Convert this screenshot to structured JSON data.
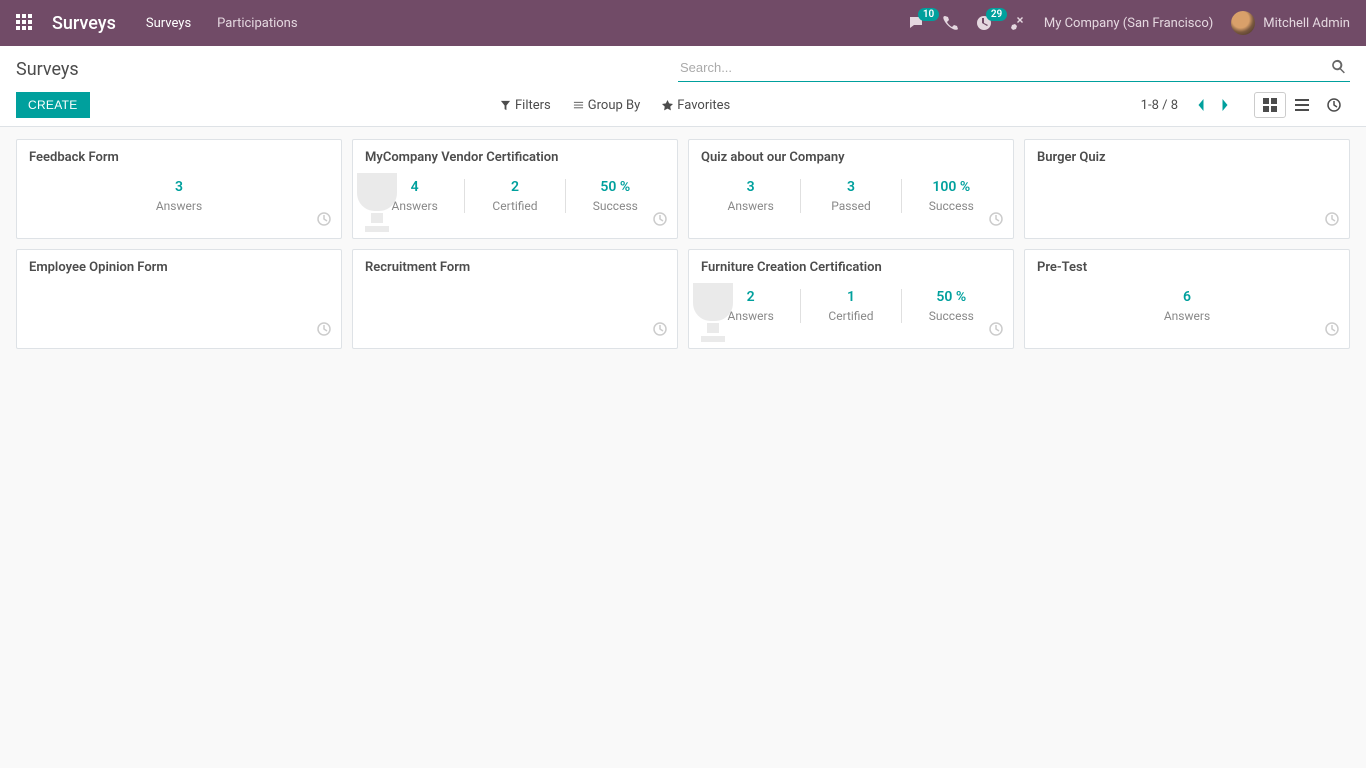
{
  "navbar": {
    "brand": "Surveys",
    "menu": [
      {
        "label": "Surveys",
        "active": true
      },
      {
        "label": "Participations",
        "active": false
      }
    ],
    "messages_count": "10",
    "activities_count": "29",
    "company": "My Company (San Francisco)",
    "user": "Mitchell Admin"
  },
  "control": {
    "breadcrumb": "Surveys",
    "search_placeholder": "Search...",
    "create_label": "CREATE",
    "filters_label": "Filters",
    "groupby_label": "Group By",
    "favorites_label": "Favorites",
    "pager": "1-8 / 8"
  },
  "stat_labels": {
    "answers": "Answers",
    "certified": "Certified",
    "passed": "Passed",
    "success": "Success"
  },
  "cards": [
    {
      "title": "Feedback Form",
      "type": "answers",
      "answers": "3"
    },
    {
      "title": "MyCompany Vendor Certification",
      "type": "cert",
      "answers": "4",
      "mid_val": "2",
      "mid_lbl": "certified",
      "success": "50 %",
      "trophy": true
    },
    {
      "title": "Quiz about our Company",
      "type": "cert",
      "answers": "3",
      "mid_val": "3",
      "mid_lbl": "passed",
      "success": "100 %"
    },
    {
      "title": "Burger Quiz",
      "type": "empty"
    },
    {
      "title": "Employee Opinion Form",
      "type": "empty"
    },
    {
      "title": "Recruitment Form",
      "type": "empty"
    },
    {
      "title": "Furniture Creation Certification",
      "type": "cert",
      "answers": "2",
      "mid_val": "1",
      "mid_lbl": "certified",
      "success": "50 %",
      "trophy": true
    },
    {
      "title": "Pre-Test",
      "type": "answers",
      "answers": "6"
    }
  ]
}
